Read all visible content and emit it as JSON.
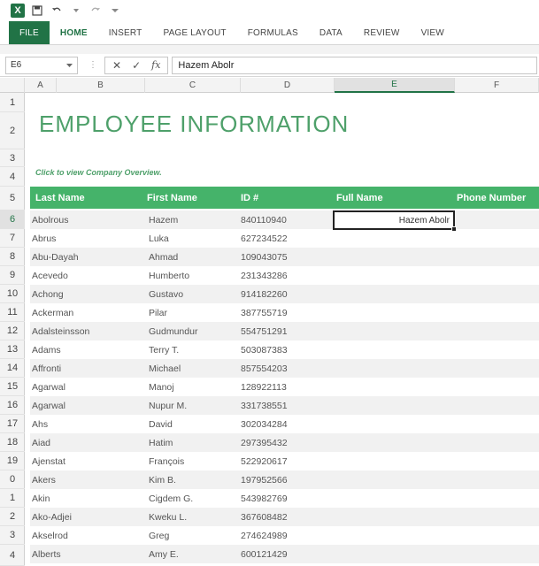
{
  "qat": {
    "logo": "X",
    "icons": [
      "save-icon",
      "undo-icon",
      "redo-icon",
      "customize-icon"
    ]
  },
  "ribbon": {
    "tabs": [
      {
        "label": "FILE"
      },
      {
        "label": "HOME"
      },
      {
        "label": "INSERT"
      },
      {
        "label": "PAGE LAYOUT"
      },
      {
        "label": "FORMULAS"
      },
      {
        "label": "DATA"
      },
      {
        "label": "REVIEW"
      },
      {
        "label": "VIEW"
      }
    ],
    "active_tab": "HOME"
  },
  "formula_bar": {
    "name_box": "E6",
    "content": "Hazem Abolr"
  },
  "columns": [
    "A",
    "B",
    "C",
    "D",
    "E",
    "F"
  ],
  "selected_column": "E",
  "rows": [
    "1",
    "2",
    "3",
    "4",
    "5",
    "6",
    "7",
    "8",
    "9",
    "10",
    "11",
    "12",
    "13",
    "14",
    "15",
    "16",
    "17",
    "18",
    "19",
    "0",
    "1",
    "2",
    "3",
    "4"
  ],
  "selected_row": "6",
  "sheet": {
    "title": "EMPLOYEE INFORMATION",
    "overview_link": "Click to view Company Overview.",
    "headers": [
      "Last Name",
      "First Name",
      "ID #",
      "Full Name",
      "Phone Number"
    ],
    "active_cell_value": "Hazem Abolr",
    "employees": [
      {
        "last": "Abolrous",
        "first": "Hazem",
        "id": "840110940"
      },
      {
        "last": "Abrus",
        "first": "Luka",
        "id": "627234522"
      },
      {
        "last": "Abu-Dayah",
        "first": "Ahmad",
        "id": "109043075"
      },
      {
        "last": "Acevedo",
        "first": "Humberto",
        "id": "231343286"
      },
      {
        "last": "Achong",
        "first": "Gustavo",
        "id": "914182260"
      },
      {
        "last": "Ackerman",
        "first": "Pilar",
        "id": "387755719"
      },
      {
        "last": "Adalsteinsson",
        "first": "Gudmundur",
        "id": "554751291"
      },
      {
        "last": "Adams",
        "first": "Terry  T.",
        "id": "503087383"
      },
      {
        "last": "Affronti",
        "first": "Michael",
        "id": "857554203"
      },
      {
        "last": "Agarwal",
        "first": "Manoj",
        "id": "128922113"
      },
      {
        "last": "Agarwal",
        "first": "Nupur  M.",
        "id": "331738551"
      },
      {
        "last": "Ahs",
        "first": "David",
        "id": "302034284"
      },
      {
        "last": "Aiad",
        "first": "Hatim",
        "id": "297395432"
      },
      {
        "last": "Ajenstat",
        "first": "François",
        "id": "522920617"
      },
      {
        "last": "Akers",
        "first": "Kim  B.",
        "id": "197952566"
      },
      {
        "last": "Akin",
        "first": "Cigdem  G.",
        "id": "543982769"
      },
      {
        "last": "Ako-Adjei",
        "first": "Kweku  L.",
        "id": "367608482"
      },
      {
        "last": "Akselrod",
        "first": "Greg",
        "id": "274624989"
      },
      {
        "last": "Alberts",
        "first": "Amy  E.",
        "id": "600121429"
      }
    ]
  },
  "colors": {
    "brand": "#217346",
    "header_fill": "#45b36a",
    "title": "#4ea06a"
  }
}
